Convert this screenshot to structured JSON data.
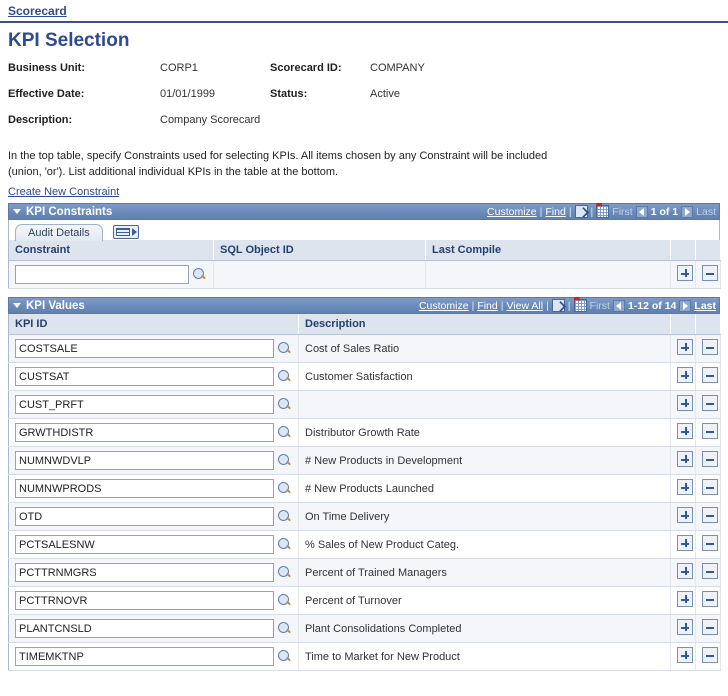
{
  "breadcrumb": {
    "label": "Scorecard"
  },
  "page": {
    "title": "KPI Selection"
  },
  "header_fields": {
    "business_unit_label": "Business Unit:",
    "business_unit_value": "CORP1",
    "scorecard_id_label": "Scorecard ID:",
    "scorecard_id_value": "COMPANY",
    "effective_date_label": "Effective Date:",
    "effective_date_value": "01/01/1999",
    "status_label": "Status:",
    "status_value": "Active",
    "description_label": "Description:",
    "description_value": "Company Scorecard"
  },
  "instructions": {
    "text": "In the top table, specify Constraints used for selecting KPIs. All items chosen by any Constraint will be included (union, 'or'). List additional individual KPIs in the table at the bottom.",
    "create_link": "Create New Constraint"
  },
  "constraints_section": {
    "title": "KPI Constraints",
    "customize": "Customize",
    "find": "Find",
    "expand_icon": "expand-icon",
    "download_icon": "download-grid-icon",
    "first": "First",
    "prev_icon": "prev-arrow-icon",
    "counter": "1 of 1",
    "next_icon": "next-arrow-icon",
    "last": "Last",
    "tabs": [
      {
        "label": "Audit Details"
      }
    ],
    "tab_icon": "show-all-columns-icon",
    "columns": [
      "Constraint",
      "SQL Object ID",
      "Last Compile"
    ],
    "rows": [
      {
        "constraint": "",
        "constraint_placeholder": "",
        "lookup_icon": "lookup-magnifier-icon",
        "sql_object_id": "",
        "last_compile": "",
        "add_icon": "add-row-icon",
        "delete_icon": "delete-row-icon"
      }
    ]
  },
  "values_section": {
    "title": "KPI Values",
    "customize": "Customize",
    "find": "Find",
    "view_all": "View All",
    "expand_icon": "expand-icon",
    "download_icon": "download-grid-icon",
    "first": "First",
    "prev_icon": "prev-arrow-icon",
    "counter": "1-12 of 14",
    "next_icon": "next-arrow-icon",
    "last": "Last",
    "columns": [
      "KPI ID",
      "Description"
    ],
    "rows": [
      {
        "kpi_id": "COSTSALE",
        "description": "Cost of Sales Ratio"
      },
      {
        "kpi_id": "CUSTSAT",
        "description": "Customer Satisfaction"
      },
      {
        "kpi_id": "CUST_PRFT",
        "description": ""
      },
      {
        "kpi_id": "GRWTHDISTR",
        "description": "Distributor Growth Rate"
      },
      {
        "kpi_id": "NUMNWDVLP",
        "description": "# New Products in Development"
      },
      {
        "kpi_id": "NUMNWPRODS",
        "description": "# New Products Launched"
      },
      {
        "kpi_id": "OTD",
        "description": "On Time Delivery"
      },
      {
        "kpi_id": "PCTSALESNW",
        "description": "% Sales of New Product Categ."
      },
      {
        "kpi_id": "PCTTRNMGRS",
        "description": "Percent of Trained Managers"
      },
      {
        "kpi_id": "PCTTRNOVR",
        "description": "Percent of Turnover"
      },
      {
        "kpi_id": "PLANTCNSLD",
        "description": "Plant Consolidations Completed"
      },
      {
        "kpi_id": "TIMEMKTNP",
        "description": "Time to Market for New Product"
      }
    ],
    "add_icon": "add-row-icon",
    "delete_icon": "delete-row-icon",
    "lookup_icon": "lookup-magnifier-icon"
  },
  "colors": {
    "brand_blue": "#2e4b8f",
    "header_bar": "#6c8cba",
    "column_header_bg": "#dde4ee",
    "row_alt_bg": "#f4f6f9",
    "accent_rule": "#3b4f97"
  }
}
